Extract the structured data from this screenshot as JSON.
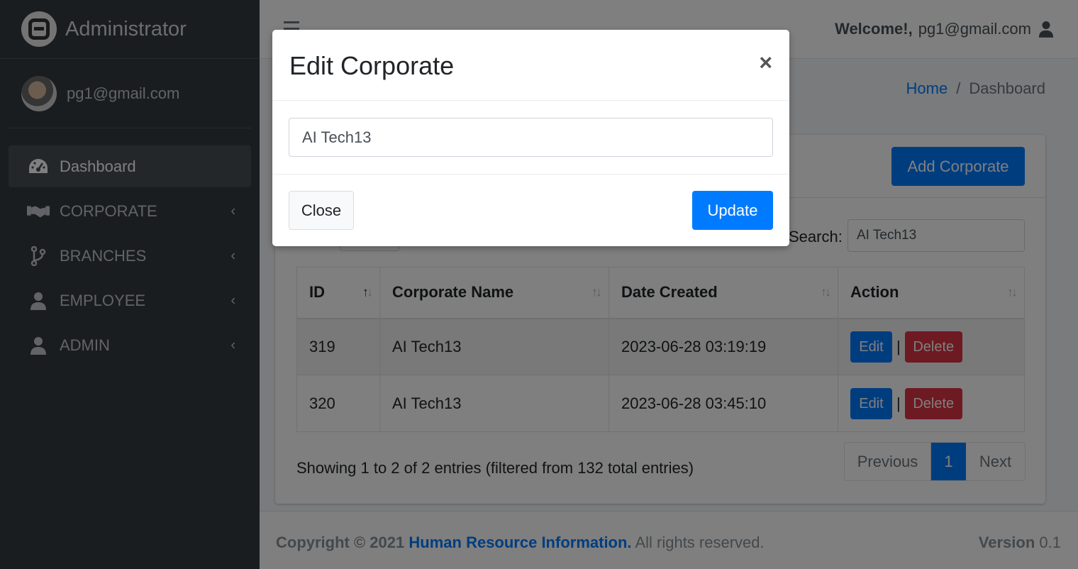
{
  "sidebar": {
    "brand": "Administrator",
    "user": "pg1@gmail.com",
    "items": [
      {
        "label": "Dashboard",
        "icon": "dashboard-icon",
        "active": true
      },
      {
        "label": "CORPORATE",
        "icon": "handshake-icon"
      },
      {
        "label": "BRANCHES",
        "icon": "branch-icon"
      },
      {
        "label": "EMPLOYEE",
        "icon": "user-icon"
      },
      {
        "label": "ADMIN",
        "icon": "user-icon"
      }
    ]
  },
  "topbar": {
    "welcome_bold": "Welcome!,",
    "welcome_user": "pg1@gmail.com"
  },
  "breadcrumb": {
    "home": "Home",
    "sep": "/",
    "current": "Dashboard"
  },
  "card": {
    "add_button": "Add Corporate",
    "search_label": "Search:",
    "search_value": "AI Tech13"
  },
  "table": {
    "headers": [
      "ID",
      "Corporate Name",
      "Date Created",
      "Action"
    ],
    "rows": [
      {
        "id": "319",
        "name": "AI Tech13",
        "date": "2023-06-28 03:19:19"
      },
      {
        "id": "320",
        "name": "AI Tech13",
        "date": "2023-06-28 03:45:10"
      }
    ],
    "edit_label": "Edit",
    "delete_label": "Delete",
    "separator": "|"
  },
  "info": "Showing 1 to 2 of 2 entries (filtered from 132 total entries)",
  "pagination": {
    "prev": "Previous",
    "page": "1",
    "next": "Next"
  },
  "footer": {
    "copyright": "Copyright © 2021",
    "org": "Human Resource Information.",
    "rights": "All rights reserved.",
    "version_label": "Version",
    "version": "0.1"
  },
  "modal": {
    "title": "Edit Corporate",
    "close_x": "×",
    "input_value": "AI Tech13",
    "close_button": "Close",
    "update_button": "Update"
  },
  "colors": {
    "primary": "#007bff",
    "danger": "#dc3545",
    "sidebar": "#343a40"
  }
}
